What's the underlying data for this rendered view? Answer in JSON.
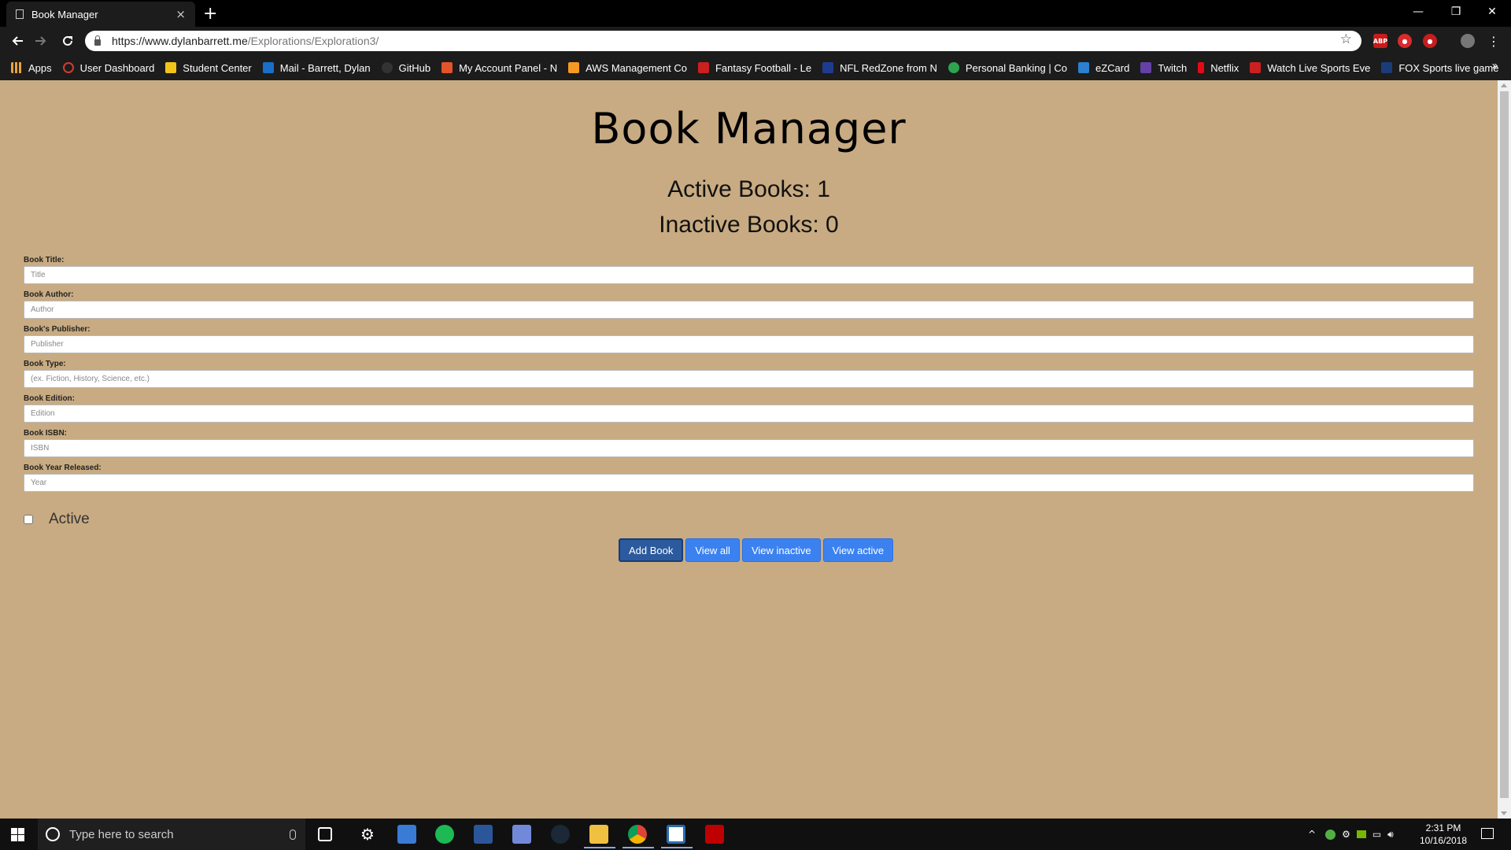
{
  "browser": {
    "tab_title": "Book Manager",
    "tab_close": "×",
    "new_tab": "+",
    "url_host": "https://www.dylanbarrett.me",
    "url_path": "/Explorations/Exploration3/",
    "window_minimize": "—",
    "window_restore": "❐",
    "window_close": "✕"
  },
  "bookmarks": [
    {
      "label": "Apps",
      "color": "#e8a33d"
    },
    {
      "label": "User Dashboard",
      "color": "#d43c2c"
    },
    {
      "label": "Student Center",
      "color": "#f0c419"
    },
    {
      "label": "Mail - Barrett, Dylan",
      "color": "#1a6fc9"
    },
    {
      "label": "GitHub",
      "color": "#333333"
    },
    {
      "label": "My Account Panel - N",
      "color": "#e2542b"
    },
    {
      "label": "AWS Management Co",
      "color": "#f59a23"
    },
    {
      "label": "Fantasy Football - Le",
      "color": "#cc1f1f"
    },
    {
      "label": "NFL RedZone from N",
      "color": "#1e3c8f"
    },
    {
      "label": "Personal Banking | Co",
      "color": "#2da44e"
    },
    {
      "label": "eZCard",
      "color": "#2d7fd0"
    },
    {
      "label": "Twitch",
      "color": "#6441a5"
    },
    {
      "label": "Netflix",
      "color": "#e50914"
    },
    {
      "label": "Watch Live Sports Eve",
      "color": "#cc1f1f"
    },
    {
      "label": "FOX Sports live game",
      "color": "#1b3c7a"
    }
  ],
  "page": {
    "title": "Book Manager",
    "active_books": "Active Books: 1",
    "inactive_books": "Inactive Books: 0",
    "fields": [
      {
        "label": "Book Title:",
        "placeholder": "Title"
      },
      {
        "label": "Book Author:",
        "placeholder": "Author"
      },
      {
        "label": "Book's Publisher:",
        "placeholder": "Publisher"
      },
      {
        "label": "Book Type:",
        "placeholder": "(ex. Fiction, History, Science, etc.)"
      },
      {
        "label": "Book Edition:",
        "placeholder": "Edition"
      },
      {
        "label": "Book ISBN:",
        "placeholder": "ISBN"
      },
      {
        "label": "Book Year Released:",
        "placeholder": "Year"
      }
    ],
    "active_label": "Active",
    "buttons": {
      "add": "Add Book",
      "view_all": "View all",
      "view_inactive": "View inactive",
      "view_active": "View active"
    },
    "background_color": "#c8ab82",
    "button_color": "#3b82f0"
  },
  "taskbar": {
    "search_placeholder": "Type here to search",
    "time": "2:31 PM",
    "date": "10/16/2018",
    "apps": [
      "task-view-icon",
      "settings-icon",
      "explorer-window-icon",
      "spotify-icon",
      "word-icon",
      "discord-icon",
      "steam-icon",
      "file-explorer-icon",
      "chrome-icon",
      "notepad-icon",
      "filezilla-icon"
    ]
  }
}
